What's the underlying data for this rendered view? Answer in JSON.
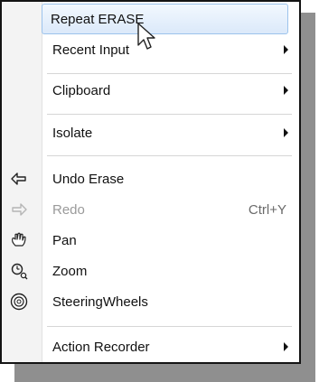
{
  "menu": {
    "items": [
      {
        "label": "Repeat ERASE"
      },
      {
        "label": "Recent Input"
      },
      {
        "label": "Clipboard"
      },
      {
        "label": "Isolate"
      },
      {
        "label": "Undo Erase",
        "icon": "undo-icon"
      },
      {
        "label": "Redo",
        "icon": "redo-icon",
        "shortcut": "Ctrl+Y",
        "disabled": true
      },
      {
        "label": "Pan",
        "icon": "pan-hand-icon"
      },
      {
        "label": "Zoom",
        "icon": "zoom-icon"
      },
      {
        "label": "SteeringWheels",
        "icon": "steering-wheels-icon"
      },
      {
        "label": "Action Recorder"
      }
    ]
  }
}
